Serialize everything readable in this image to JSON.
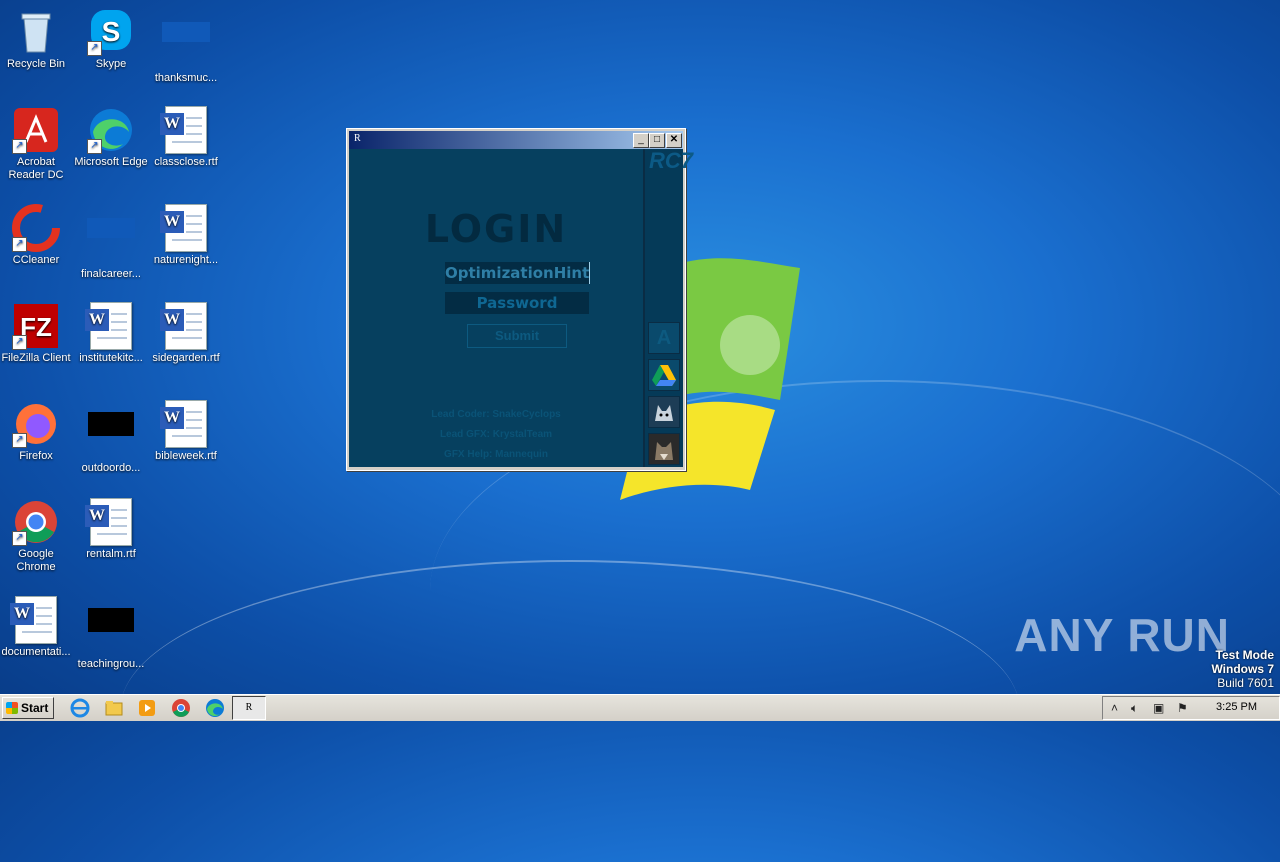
{
  "desktop_icons": [
    {
      "label": "Recycle Bin"
    },
    {
      "label": "Skype"
    },
    {
      "label": "thanksmuc..."
    },
    {
      "label": "Acrobat Reader DC"
    },
    {
      "label": "Microsoft Edge"
    },
    {
      "label": "classclose.rtf"
    },
    {
      "label": "CCleaner"
    },
    {
      "label": "finalcareer..."
    },
    {
      "label": "naturenight..."
    },
    {
      "label": "FileZilla Client"
    },
    {
      "label": "institutekitc..."
    },
    {
      "label": "sidegarden.rtf"
    },
    {
      "label": "Firefox"
    },
    {
      "label": "outdoordo..."
    },
    {
      "label": "bibleweek.rtf"
    },
    {
      "label": "Google Chrome"
    },
    {
      "label": "rentalm.rtf"
    },
    {
      "label": "documentati..."
    },
    {
      "label": "teachingrou..."
    }
  ],
  "window": {
    "title": "R",
    "side_logo": "RC7",
    "login_title": "LOGIN",
    "username_value": "OptimizationHints",
    "password_placeholder": "Password",
    "submit_label": "Submit",
    "side_button_a": "A",
    "credits": [
      "Lead Coder: SnakeCyclops",
      "Lead GFX: KrystalTeam",
      "GFX Help: Mannequin"
    ]
  },
  "taskbar": {
    "start_label": "Start",
    "app_button": "R",
    "clock": "3:25 PM"
  },
  "watermark": "ANY RUN",
  "test_mode": {
    "line1": "Test Mode",
    "line2": "Windows 7",
    "line3": "Build 7601"
  }
}
